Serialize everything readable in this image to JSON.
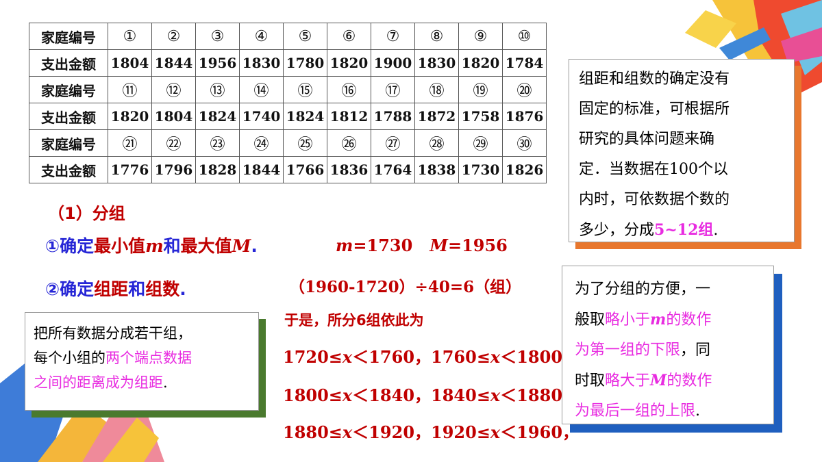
{
  "table": {
    "rows": [
      {
        "kind": "id",
        "label": "家庭编号",
        "cells": [
          "①",
          "②",
          "③",
          "④",
          "⑤",
          "⑥",
          "⑦",
          "⑧",
          "⑨",
          "⑩"
        ]
      },
      {
        "kind": "amt",
        "label": "支出金额",
        "cells": [
          "1804",
          "1844",
          "1956",
          "1830",
          "1780",
          "1820",
          "1900",
          "1830",
          "1820",
          "1784"
        ]
      },
      {
        "kind": "id",
        "label": "家庭编号",
        "cells": [
          "⑪",
          "⑫",
          "⑬",
          "⑭",
          "⑮",
          "⑯",
          "⑰",
          "⑱",
          "⑲",
          "⑳"
        ]
      },
      {
        "kind": "amt",
        "label": "支出金额",
        "cells": [
          "1820",
          "1804",
          "1824",
          "1740",
          "1824",
          "1812",
          "1788",
          "1872",
          "1758",
          "1876"
        ]
      },
      {
        "kind": "id",
        "label": "家庭编号",
        "cells": [
          "㉑",
          "㉒",
          "㉓",
          "㉔",
          "㉕",
          "㉖",
          "㉗",
          "㉘",
          "㉙",
          "㉚"
        ]
      },
      {
        "kind": "amt",
        "label": "支出金额",
        "cells": [
          "1776",
          "1796",
          "1828",
          "1844",
          "1766",
          "1836",
          "1764",
          "1838",
          "1730",
          "1826"
        ]
      }
    ]
  },
  "section_title": "（1）分组",
  "step1": {
    "prefix": "①确定",
    "t1": "最小值",
    "m": "m",
    "t2": "和",
    "t3": "最大值",
    "M": "M",
    "dot": "."
  },
  "step1_result": {
    "m": "m",
    "eq1": "=1730",
    "M": "M",
    "eq2": "=1956"
  },
  "step2": {
    "prefix": "②确定",
    "t1": "组距",
    "t2": "和",
    "t3": "组数",
    "dot": "."
  },
  "calc": "（1960-1720）÷40=6（组）",
  "intro": "于是，所分6组依此为",
  "ranges": [
    {
      "a": "1720≤",
      "x": "x",
      "b": "＜1760，",
      "c": "1760≤",
      "x2": "x",
      "d": "＜1800，"
    },
    {
      "a": "1800≤",
      "x": "x",
      "b": "＜1840，",
      "c": "1840≤",
      "x2": "x",
      "d": "＜1880，"
    },
    {
      "a": "1880≤",
      "x": "x",
      "b": "＜1920，",
      "c": "1920≤",
      "x2": "x",
      "d": "＜1960，"
    }
  ],
  "note_left": {
    "l1": "把所有数据分成若干组，",
    "l2a": "每个小组的",
    "l2b": "两个端点数据",
    "l3a": "之间的距离成为组距",
    "l3b": "."
  },
  "note_top": {
    "l1": "组距和组数的确定没有",
    "l2": "固定的标准，可根据所",
    "l3": "研究的具体问题来确",
    "l4": "定．当数据在100个以",
    "l5": "内时，可依数据个数的",
    "l6a": "多少，分成",
    "l6b": "5~12组",
    "l6c": "."
  },
  "note_right": {
    "l1": "为了分组的方便，一",
    "l2a": "般取",
    "l2b": "略小于",
    "l2c": "m",
    "l2d": "的数作",
    "l3a": "为第一组的下限",
    "l3b": "，同",
    "l4a": "时取",
    "l4b": "略大于",
    "l4c": "M",
    "l4d": "的数作",
    "l5a": "为最后一组的上限",
    "l5b": "."
  },
  "colors": {
    "red": "#c00000",
    "blue": "#2626d6",
    "magenta": "#e82be0",
    "orange_shadow": "#e8772e",
    "green_shadow": "#4a7a2e",
    "blue_shadow": "#1f5fbf"
  }
}
